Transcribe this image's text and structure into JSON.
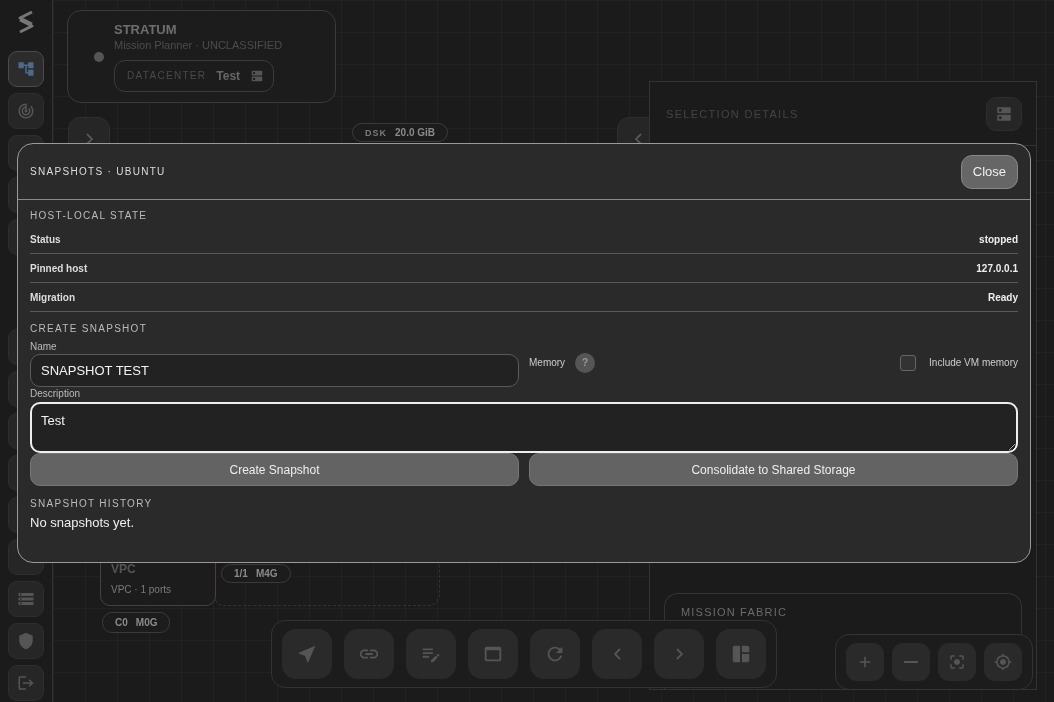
{
  "sidebar": {
    "top_items": [
      {
        "selected": true
      },
      {
        "selected": false
      },
      {
        "selected": false
      },
      {
        "selected": false
      },
      {
        "selected": false
      }
    ],
    "bottom_items": [
      {
        "selected": false
      },
      {
        "selected": false
      },
      {
        "selected": false
      },
      {
        "selected": false
      },
      {
        "selected": false
      },
      {
        "selected": false
      },
      {
        "selected": false
      },
      {
        "selected": false
      },
      {
        "selected": false
      }
    ]
  },
  "header_card": {
    "title": "STRATUM",
    "subtitle": "Mission Planner · UNCLASSIFIED",
    "datacenter_label": "DATACENTER",
    "datacenter_value": "Test"
  },
  "canvas": {
    "disk_chip": {
      "label": "DSK",
      "value": "20.0 GiB"
    },
    "vpc_node": {
      "title": "VPC",
      "subtitle": "VPC · 1 ports"
    },
    "node_chips": [
      "1/1",
      "M4G"
    ],
    "resource_chip": [
      "C0",
      "M0G"
    ]
  },
  "selection_details": {
    "title": "SELECTION DETAILS",
    "card_title": "MISSION FABRIC"
  },
  "modal": {
    "title": "SNAPSHOTS · UBUNTU",
    "close_label": "Close",
    "host_state": {
      "heading": "HOST-LOCAL STATE",
      "rows": [
        {
          "label": "Status",
          "value": "stopped"
        },
        {
          "label": "Pinned host",
          "value": "127.0.0.1"
        },
        {
          "label": "Migration",
          "value": "Ready"
        }
      ]
    },
    "create": {
      "heading": "CREATE SNAPSHOT",
      "name_label": "Name",
      "name_value": "SNAPSHOT TEST",
      "memory_label": "Memory",
      "memory_help": "?",
      "include_memory": {
        "label": "Include VM memory",
        "checked": false
      },
      "description_label": "Description",
      "description_value": "Test",
      "buttons": [
        "Create Snapshot",
        "Consolidate to Shared Storage"
      ]
    },
    "history": {
      "heading": "SNAPSHOT HISTORY",
      "empty_text": "No snapshots yet."
    }
  }
}
